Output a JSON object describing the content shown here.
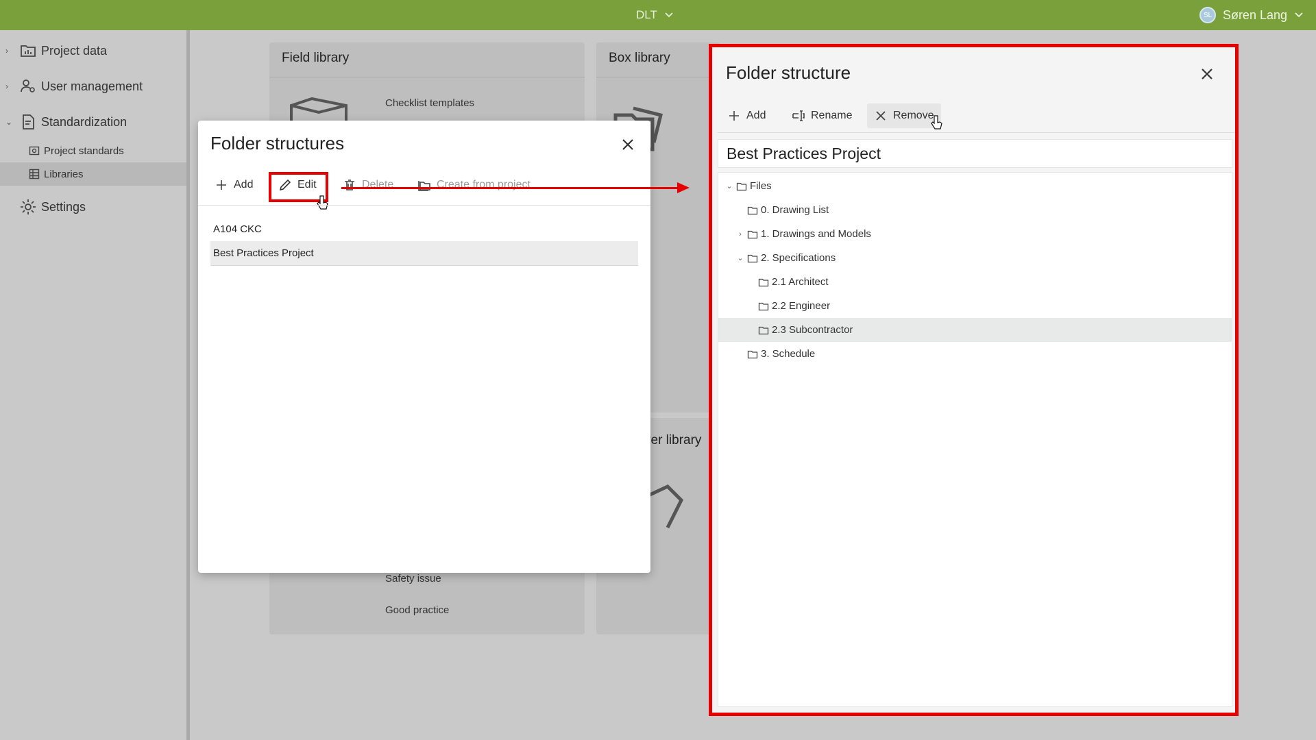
{
  "topbar": {
    "project": "DLT",
    "user_name": "Søren Lang",
    "user_initials": "SL"
  },
  "sidebar": {
    "items": [
      {
        "label": "Project data",
        "icon": "project-data-icon"
      },
      {
        "label": "User management",
        "icon": "user-management-icon"
      },
      {
        "label": "Standardization",
        "icon": "standardization-icon"
      },
      {
        "label": "Settings",
        "icon": "gear-icon"
      }
    ],
    "sub_items": [
      {
        "label": "Project standards",
        "icon": "project-standards-icon"
      },
      {
        "label": "Libraries",
        "icon": "grid-icon"
      }
    ]
  },
  "background": {
    "field_library": {
      "title": "Field library",
      "links": [
        "Checklist templates",
        "Safety issue",
        "Good practice"
      ]
    },
    "box_library": {
      "title": "Box library"
    },
    "third_card": {
      "title": "ver library"
    }
  },
  "folder_structures_dialog": {
    "title": "Folder structures",
    "toolbar": {
      "add": "Add",
      "edit": "Edit",
      "delete": "Delete",
      "create_from_project": "Create from project"
    },
    "rows": [
      "A104 CKC",
      "Best Practices Project"
    ],
    "selected_index": 1
  },
  "folder_structure_panel": {
    "title": "Folder structure",
    "toolbar": {
      "add": "Add",
      "rename": "Rename",
      "remove": "Remove"
    },
    "structure_name": "Best Practices Project",
    "tree": [
      {
        "label": "Files",
        "expander": "expanded"
      },
      {
        "label": "0. Drawing List",
        "expander": "none"
      },
      {
        "label": "1. Drawings and Models",
        "expander": "collapsed"
      },
      {
        "label": "2. Specifications",
        "expander": "expanded"
      },
      {
        "label": "2.1 Architect",
        "expander": "none"
      },
      {
        "label": "2.2 Engineer",
        "expander": "none"
      },
      {
        "label": "2.3 Subcontractor",
        "expander": "none",
        "selected": true
      },
      {
        "label": "3. Schedule",
        "expander": "none"
      }
    ]
  },
  "colors": {
    "brand_green": "#7aa03b",
    "highlight_red": "#e60000"
  }
}
